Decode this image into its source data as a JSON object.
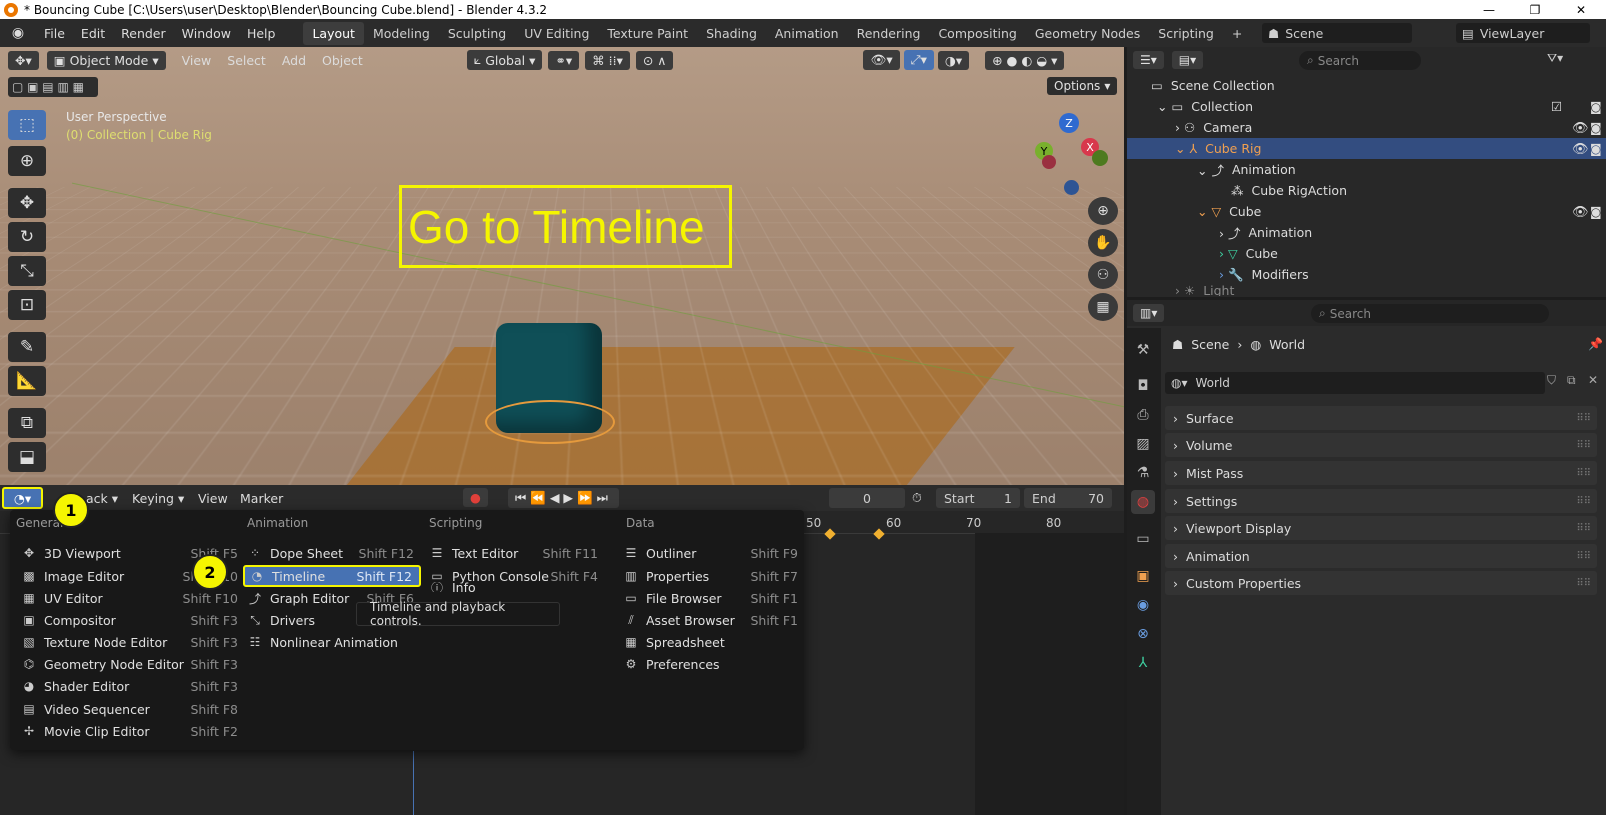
{
  "titlebar": {
    "title": "* Bouncing Cube [C:\\Users\\user\\Desktop\\Blender\\Bouncing Cube.blend] - Blender 4.3.2",
    "minimize": "—",
    "maximize": "❐",
    "close": "✕"
  },
  "menubar": {
    "menus": [
      "File",
      "Edit",
      "Render",
      "Window",
      "Help"
    ],
    "workspaces": [
      "Layout",
      "Modeling",
      "Sculpting",
      "UV Editing",
      "Texture Paint",
      "Shading",
      "Animation",
      "Rendering",
      "Compositing",
      "Geometry Nodes",
      "Scripting"
    ],
    "add_tab": "+",
    "scene": "Scene",
    "view_layer": "ViewLayer"
  },
  "viewport": {
    "mode": "Object Mode",
    "menus": [
      "View",
      "Select",
      "Add",
      "Object"
    ],
    "orientation": "Global",
    "options": "Options",
    "perspective_label": "User Perspective",
    "collection_label": "(0) Collection | Cube Rig",
    "gizmo": {
      "z": "Z",
      "x": "X",
      "y": "Y"
    }
  },
  "annotation": {
    "text": "Go to Timeline",
    "step1": "1",
    "step2": "2"
  },
  "timeline": {
    "playback": "ack",
    "keying": "Keying",
    "view": "View",
    "marker": "Marker",
    "frame": "0",
    "start_label": "Start",
    "start": "1",
    "end_label": "End",
    "end": "70",
    "ruler": [
      "50",
      "60",
      "70",
      "80"
    ]
  },
  "editor_menu": {
    "general": {
      "header": "General",
      "items": [
        {
          "label": "3D Viewport",
          "shortcut": "Shift F5"
        },
        {
          "label": "Image Editor",
          "shortcut": "Shift F10"
        },
        {
          "label": "UV Editor",
          "shortcut": "Shift F10"
        },
        {
          "label": "Compositor",
          "shortcut": "Shift F3"
        },
        {
          "label": "Texture Node Editor",
          "shortcut": "Shift F3"
        },
        {
          "label": "Geometry Node Editor",
          "shortcut": "Shift F3"
        },
        {
          "label": "Shader Editor",
          "shortcut": "Shift F3"
        },
        {
          "label": "Video Sequencer",
          "shortcut": "Shift F8"
        },
        {
          "label": "Movie Clip Editor",
          "shortcut": "Shift F2"
        }
      ]
    },
    "animation": {
      "header": "Animation",
      "items": [
        {
          "label": "Dope Sheet",
          "shortcut": "Shift F12"
        },
        {
          "label": "Timeline",
          "shortcut": "Shift F12"
        },
        {
          "label": "Graph Editor",
          "shortcut": "Shift F6"
        },
        {
          "label": "Drivers",
          "shortcut": ""
        },
        {
          "label": "Nonlinear Animation",
          "shortcut": ""
        }
      ]
    },
    "scripting": {
      "header": "Scripting",
      "items": [
        {
          "label": "Text Editor",
          "shortcut": "Shift F11"
        },
        {
          "label": "Python Console",
          "shortcut": "Shift F4"
        },
        {
          "label": "Info",
          "shortcut": ""
        }
      ]
    },
    "data": {
      "header": "Data",
      "items": [
        {
          "label": "Outliner",
          "shortcut": "Shift F9"
        },
        {
          "label": "Properties",
          "shortcut": "Shift F7"
        },
        {
          "label": "File Browser",
          "shortcut": "Shift F1"
        },
        {
          "label": "Asset Browser",
          "shortcut": "Shift F1"
        },
        {
          "label": "Spreadsheet",
          "shortcut": ""
        },
        {
          "label": "Preferences",
          "shortcut": ""
        }
      ]
    },
    "tooltip": "Timeline and playback controls."
  },
  "outliner": {
    "search_placeholder": "Search",
    "rows": [
      "Scene Collection",
      "Collection",
      "Camera",
      "Cube Rig",
      "Animation",
      "Cube RigAction",
      "Cube",
      "Animation",
      "Cube",
      "Modifiers",
      "Light"
    ]
  },
  "properties": {
    "search_placeholder": "Search",
    "breadcrumb": [
      "Scene",
      "World"
    ],
    "world_name": "World",
    "panels": [
      "Surface",
      "Volume",
      "Mist Pass",
      "Settings",
      "Viewport Display",
      "Animation",
      "Custom Properties"
    ]
  }
}
